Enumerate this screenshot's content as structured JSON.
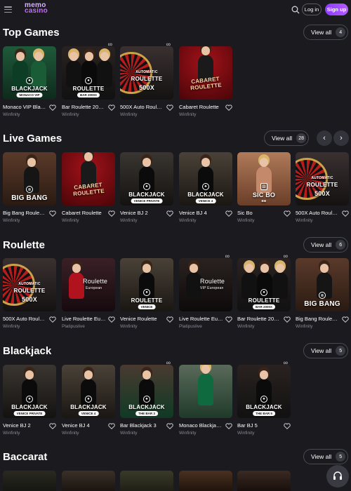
{
  "header": {
    "logo_line1": "memo",
    "logo_line2": "casino",
    "login_label": "Log in",
    "signup_label": "Sign up"
  },
  "sections": [
    {
      "title": "Top Games",
      "view_all": "View all",
      "count": "4",
      "games": [
        {
          "title": "Monaco VIP Bla…",
          "provider": "Winfinity",
          "name": "BLACKJACK",
          "sub": "MONACO VIP"
        },
        {
          "title": "Bar Roulette 20…",
          "provider": "Winfinity",
          "name": "ROULETTE",
          "sub": "BAR 2000X"
        },
        {
          "title": "500X Auto Roul…",
          "provider": "Winfinity",
          "name": "ROULETTE",
          "sub": "500X",
          "top": "AUTOMATIC"
        },
        {
          "title": "Cabaret Roulette",
          "provider": "Winfinity",
          "name": "CABARET ROULETTE"
        }
      ]
    },
    {
      "title": "Live Games",
      "view_all": "View all",
      "count": "28",
      "games": [
        {
          "title": "Big Bang Roule…",
          "provider": "Winfinity",
          "name": "BIG BANG"
        },
        {
          "title": "Cabaret Roulette",
          "provider": "Winfinity",
          "name": "CABARET ROULETTE"
        },
        {
          "title": "Venice BJ 2",
          "provider": "Winfinity",
          "name": "BLACKJACK",
          "sub": "VENICE PRIVATE"
        },
        {
          "title": "Venice BJ 4",
          "provider": "Winfinity",
          "name": "BLACKJACK",
          "sub": "VENICE 4"
        },
        {
          "title": "Sic Bo",
          "provider": "Winfinity",
          "name": "SIC BO",
          "sub": "BB"
        },
        {
          "title": "500X Auto Roul…",
          "provider": "Winfinity",
          "name": "ROULETTE",
          "sub": "500X",
          "top": "AUTOMATIC"
        }
      ]
    },
    {
      "title": "Roulette",
      "view_all": "View all",
      "count": "6",
      "games": [
        {
          "title": "500X Auto Roul…",
          "provider": "Winfinity",
          "name": "ROULETTE",
          "sub": "500X",
          "top": "AUTOMATIC"
        },
        {
          "title": "Live Roulette Eu…",
          "provider": "Platipuslive",
          "name": "Roulette",
          "sub": "European"
        },
        {
          "title": "Venice Roulette",
          "provider": "Winfinity",
          "name": "ROULETTE",
          "sub": "VENICE"
        },
        {
          "title": "Live Roulette Eu…",
          "provider": "Platipuslive",
          "name": "Roulette",
          "sub": "VIP European"
        },
        {
          "title": "Bar Roulette 20…",
          "provider": "Winfinity",
          "name": "ROULETTE",
          "sub": "BAR 2000X"
        },
        {
          "title": "Big Bang Roule…",
          "provider": "Winfinity",
          "name": "BIG BANG"
        }
      ]
    },
    {
      "title": "Blackjack",
      "view_all": "View all",
      "count": "5",
      "games": [
        {
          "title": "Venice BJ 2",
          "provider": "Winfinity",
          "name": "BLACKJACK",
          "sub": "VENICE PRIVATE"
        },
        {
          "title": "Venice BJ 4",
          "provider": "Winfinity",
          "name": "BLACKJACK",
          "sub": "VENICE 4"
        },
        {
          "title": "Bar Blackjack 3",
          "provider": "Winfinity",
          "name": "BLACKJACK",
          "sub": "THE BAR 3"
        },
        {
          "title": "Monaco Blackja…",
          "provider": "Winfinity"
        },
        {
          "title": "Bar BJ 5",
          "provider": "Winfinity",
          "name": "BLACKJACK",
          "sub": "THE BAR 5"
        }
      ]
    },
    {
      "title": "Baccarat",
      "view_all": "View all",
      "count": "5",
      "games": [
        {},
        {},
        {},
        {},
        {}
      ]
    }
  ],
  "colors": {
    "background": "#1a1a1f",
    "accent": "#b45cff",
    "provider_text": "#8a8a93"
  },
  "icons": [
    "menu-icon",
    "search-icon",
    "heart-icon",
    "infinity-icon",
    "chevron-left-icon",
    "chevron-right-icon",
    "help-headset-icon"
  ]
}
